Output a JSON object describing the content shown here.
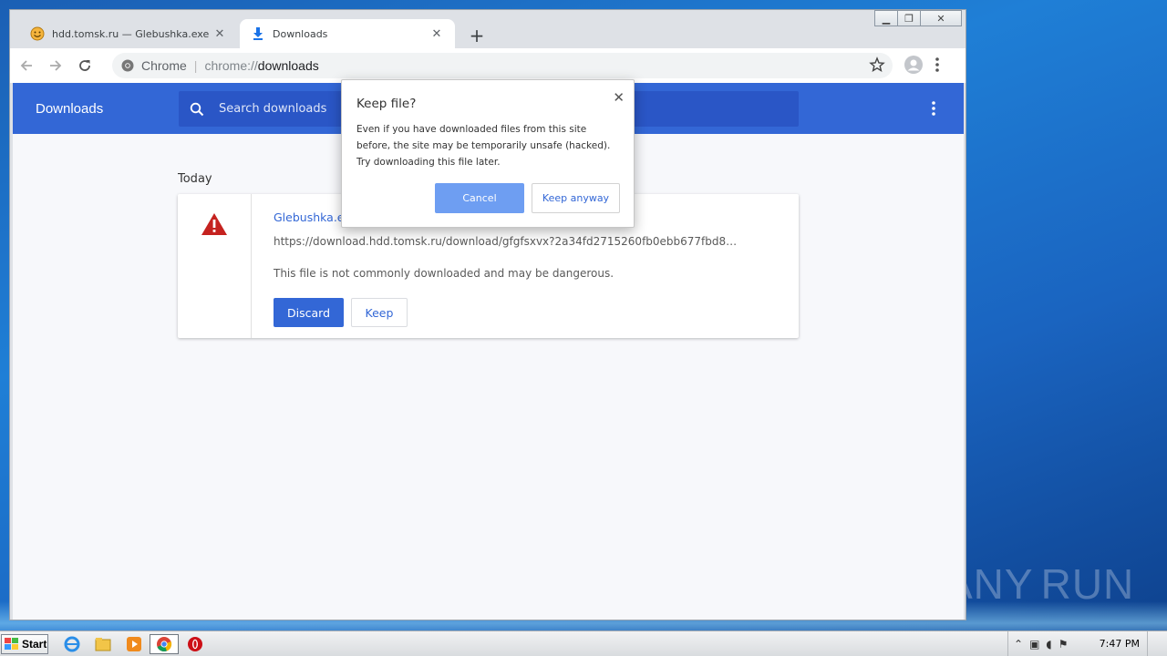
{
  "browser": {
    "tabs": [
      {
        "title": "hdd.tomsk.ru — Glebushka.exe",
        "favicon": "smiley-icon",
        "active": false
      },
      {
        "title": "Downloads",
        "favicon": "download-icon",
        "active": true
      }
    ],
    "new_tab_glyph": "+",
    "omnibox": {
      "chip": "Chrome",
      "scheme": "chrome://",
      "host": "downloads"
    }
  },
  "downloads_page": {
    "header_title": "Downloads",
    "search_placeholder": "Search downloads",
    "section_label": "Today",
    "item": {
      "filename": "Glebushka.exe",
      "url": "https://download.hdd.tomsk.ru/download/gfgfsxvx?2a34fd2715260fb0ebb677fbd825b…",
      "warning": "This file is not commonly downloaded and may be dangerous.",
      "discard_label": "Discard",
      "keep_label": "Keep"
    }
  },
  "dialog": {
    "title": "Keep file?",
    "body": "Even if you have downloaded files from this site before, the site may be temporarily unsafe (hacked). Try downloading this file later.",
    "cancel_label": "Cancel",
    "keep_anyway_label": "Keep anyway"
  },
  "taskbar": {
    "start_label": "Start",
    "clock": "7:47 PM"
  },
  "watermark": {
    "left": "ANY",
    "right": "RUN"
  },
  "colors": {
    "accent": "#3367d6",
    "header": "#3367d6",
    "danger": "#c5221f"
  }
}
